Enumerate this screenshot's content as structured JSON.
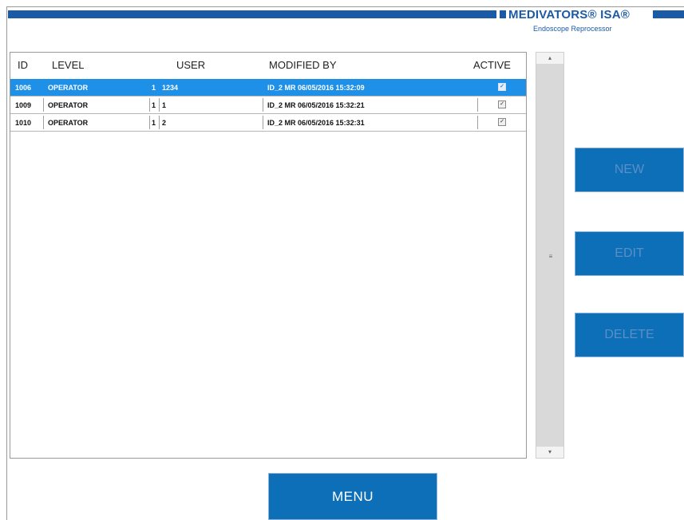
{
  "brand": {
    "title": "MEDIVATORS® ISA®",
    "subtitle": "Endoscope Reprocessor"
  },
  "table": {
    "headers": {
      "id": "ID",
      "level": "LEVEL",
      "user": "USER",
      "modified_by": "MODIFIED BY",
      "active": "ACTIVE"
    },
    "rows": [
      {
        "id": "1006",
        "level": "OPERATOR",
        "num": "1",
        "user": "1234",
        "modified_by": "ID_2 MR 06/05/2016 15:32:09",
        "active": true,
        "selected": true
      },
      {
        "id": "1009",
        "level": "OPERATOR",
        "num": "1",
        "user": "1",
        "modified_by": "ID_2 MR 06/05/2016 15:32:21",
        "active": true,
        "selected": false
      },
      {
        "id": "1010",
        "level": "OPERATOR",
        "num": "1",
        "user": "2",
        "modified_by": "ID_2 MR 06/05/2016 15:32:31",
        "active": true,
        "selected": false
      }
    ]
  },
  "scrollbar": {
    "up": "▴",
    "down": "▾",
    "grip": "≡"
  },
  "buttons": {
    "new": "NEW",
    "edit": "EDIT",
    "delete": "DELETE",
    "menu": "MENU"
  },
  "colors": {
    "brand_blue": "#1a5aa6",
    "selection": "#1e90e8",
    "button": "#0d6fb8"
  }
}
